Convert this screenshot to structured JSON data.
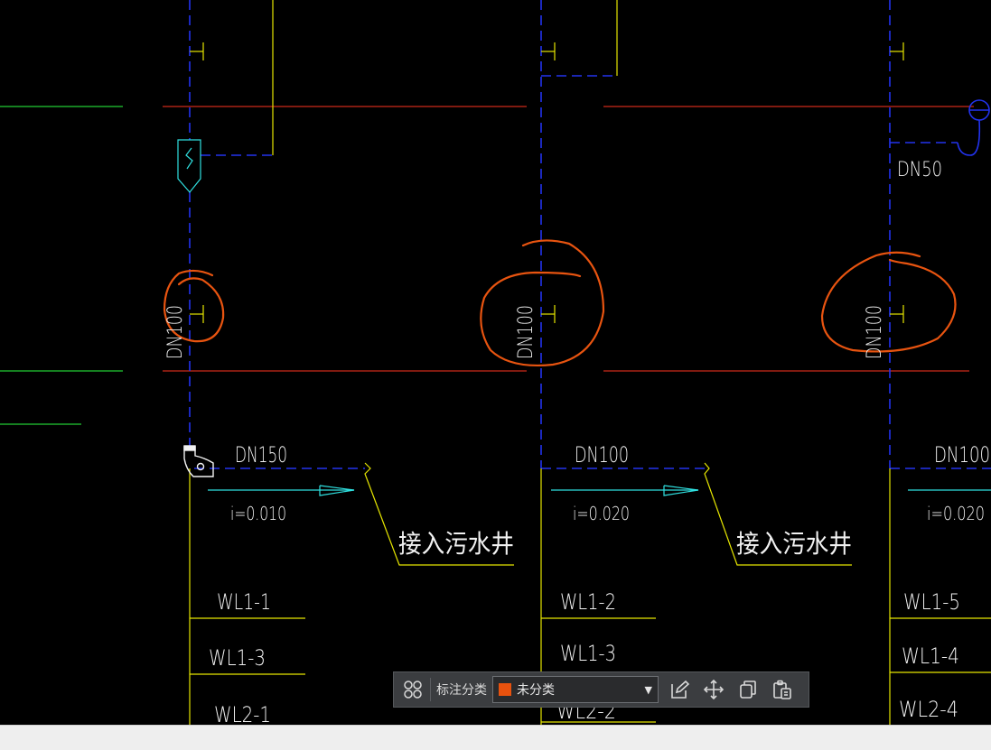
{
  "labels": {
    "dn50": "DN50",
    "dn100_a": "DN100",
    "dn100_b": "DN100",
    "dn100_c": "DN100",
    "dn150": "DN150",
    "dn100_d": "DN100",
    "dn100_e": "DN100",
    "slope_1": "i=0.010",
    "slope_2": "i=0.020",
    "slope_3": "i=0.020",
    "sewer_1": "接入污水井",
    "sewer_2": "接入污水井",
    "wl_1_1": "WL1-1",
    "wl_1_3a": "WL1-3",
    "wl_2_1": "WL2-1",
    "wl_1_2": "WL1-2",
    "wl_1_3b": "WL1-3",
    "wl_2_2": "WL2-2",
    "wl_1_5": "WL1-5",
    "wl_1_4": "WL1-4",
    "wl_2_4": "WL2-4"
  },
  "toolbar": {
    "category_label": "标注分类",
    "category_value": "未分类",
    "category_color": "#e8520e",
    "icons": [
      "grid-icon",
      "edit-icon",
      "move-icon",
      "copy-icon",
      "paste-icon"
    ]
  },
  "colors": {
    "pipe_blue": "#2233ee",
    "line_yellow": "#e6e600",
    "line_red": "#cc2b1a",
    "line_green": "#22cc33",
    "line_cyan": "#2fe0e0",
    "markup_orange": "#e85410",
    "text_white": "#f2f2f2"
  }
}
